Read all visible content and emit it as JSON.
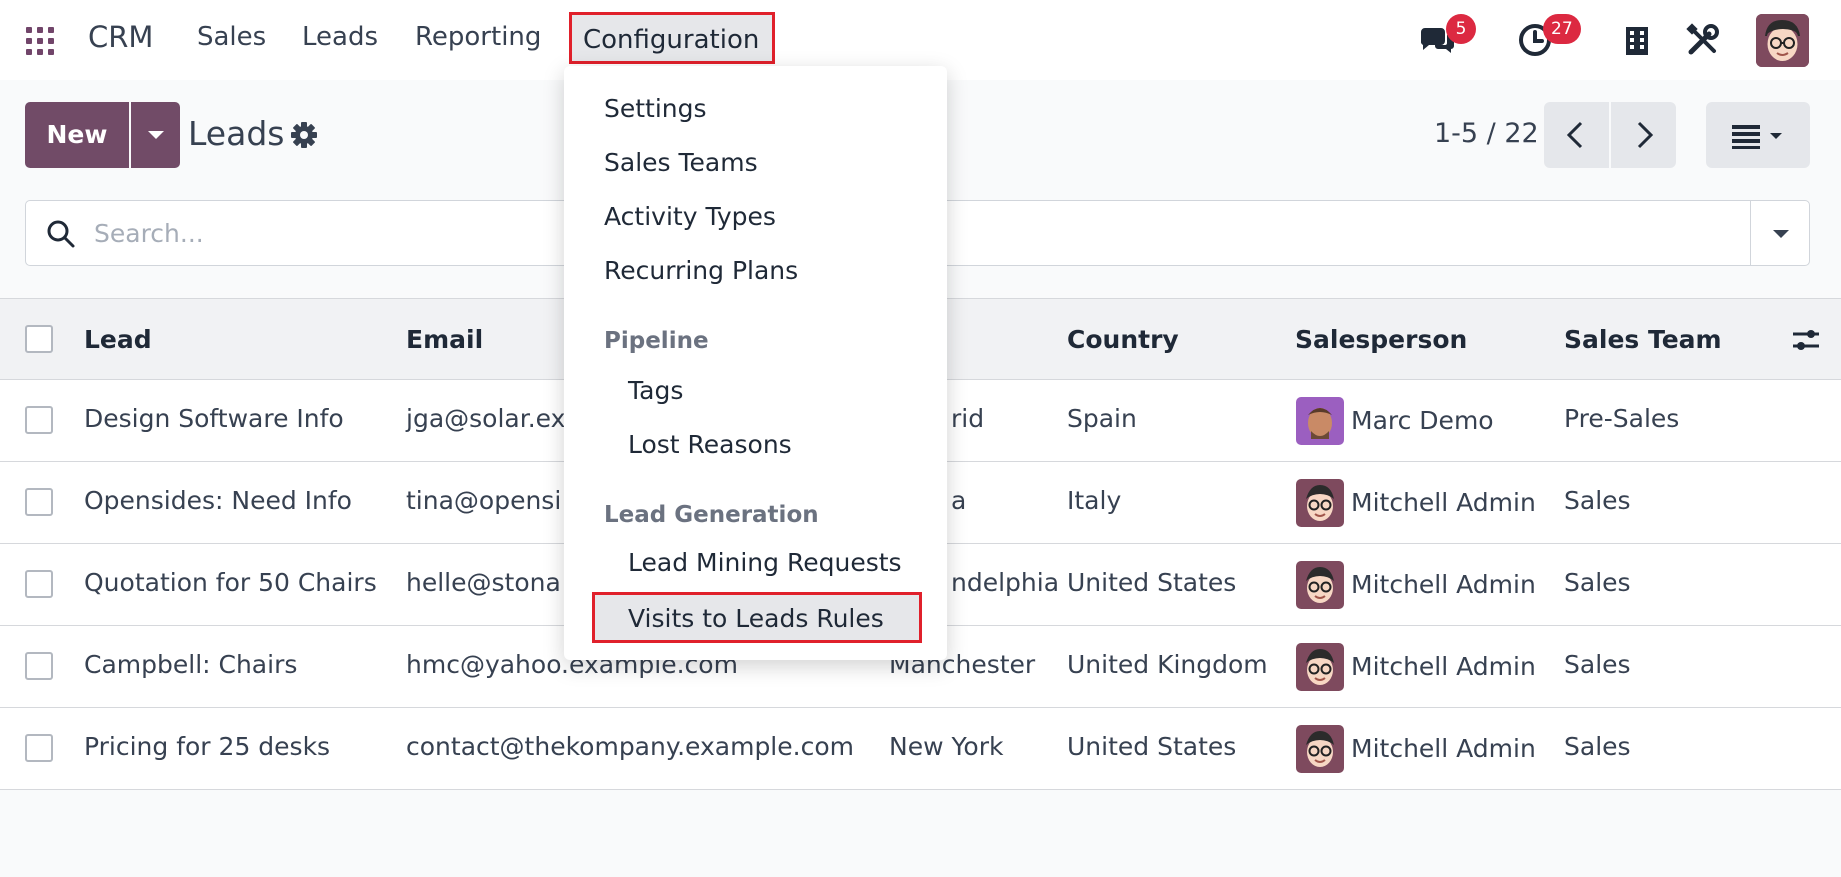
{
  "nav": {
    "brand": "CRM",
    "items": [
      "Sales",
      "Leads",
      "Reporting"
    ],
    "active": "Configuration",
    "messages_count": "5",
    "activities_count": "27"
  },
  "controls": {
    "new_label": "New",
    "title": "Leads",
    "pager": "1-5 / 22"
  },
  "search": {
    "placeholder": "Search..."
  },
  "table": {
    "columns": [
      "Lead",
      "Email",
      "",
      "Country",
      "Salesperson",
      "Sales Team"
    ],
    "rows": [
      {
        "lead": "Design Software Info",
        "email": "jga@solar.ex",
        "city": "rid",
        "country": "Spain",
        "salesperson": "Marc Demo",
        "team": "Pre-Sales"
      },
      {
        "lead": "Opensides: Need Info",
        "email": "tina@opensi",
        "city": "a",
        "country": "Italy",
        "salesperson": "Mitchell Admin",
        "team": "Sales"
      },
      {
        "lead": "Quotation for 50 Chairs",
        "email": "helle@stona",
        "city": "ndelphia",
        "country": "United States",
        "salesperson": "Mitchell Admin",
        "team": "Sales"
      },
      {
        "lead": "Campbell: Chairs",
        "email": "hmc@yahoo.example.com",
        "city": "Manchester",
        "country": "United Kingdom",
        "salesperson": "Mitchell Admin",
        "team": "Sales"
      },
      {
        "lead": "Pricing for 25 desks",
        "email": "contact@thekompany.example.com",
        "city": "New York",
        "country": "United States",
        "salesperson": "Mitchell Admin",
        "team": "Sales"
      }
    ]
  },
  "menu": {
    "items": [
      "Settings",
      "Sales Teams",
      "Activity Types",
      "Recurring Plans"
    ],
    "pipeline_header": "Pipeline",
    "pipeline_items": [
      "Tags",
      "Lost Reasons"
    ],
    "leadgen_header": "Lead Generation",
    "leadgen_items": [
      "Lead Mining Requests",
      "Visits to Leads Rules"
    ]
  },
  "colors": {
    "brand": "#714b67",
    "highlight": "#e0202b",
    "badge": "#dc2941"
  }
}
